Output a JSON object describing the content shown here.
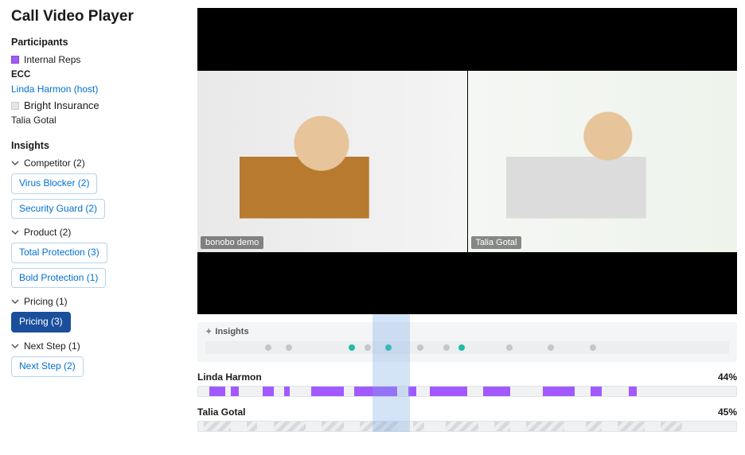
{
  "page_title": "Call Video Player",
  "participants": {
    "heading": "Participants",
    "legend_label": "Internal Reps",
    "legend_color": "#a259ff",
    "internal_org": "ECC",
    "internal_member": "Linda Harmon (host)",
    "external_org": "Bright Insurance",
    "external_member": "Talia Gotal"
  },
  "insights": {
    "heading": "Insights",
    "groups": [
      {
        "label": "Competitor",
        "count": 2,
        "chips": [
          {
            "label": "Virus Blocker",
            "count": 2,
            "active": false
          },
          {
            "label": "Security Guard",
            "count": 2,
            "active": false
          }
        ]
      },
      {
        "label": "Product",
        "count": 2,
        "chips": [
          {
            "label": "Total Protection",
            "count": 3,
            "active": false
          },
          {
            "label": "Bold Protection",
            "count": 1,
            "active": false
          }
        ]
      },
      {
        "label": "Pricing",
        "count": 1,
        "chips": [
          {
            "label": "Pricing",
            "count": 3,
            "active": true
          }
        ]
      },
      {
        "label": "Next Step",
        "count": 1,
        "chips": [
          {
            "label": "Next Step",
            "count": 2,
            "active": false
          }
        ]
      }
    ]
  },
  "video": {
    "tiles": [
      {
        "label": "bonobo demo"
      },
      {
        "label": "Talia Gotal"
      }
    ]
  },
  "timeline": {
    "insights_label": "Insights",
    "playhead_percent": 32.5,
    "playhead_width_percent": 6.9,
    "dots": [
      {
        "pos": 12,
        "kind": "grey"
      },
      {
        "pos": 16,
        "kind": "grey"
      },
      {
        "pos": 28,
        "kind": "teal"
      },
      {
        "pos": 31,
        "kind": "grey"
      },
      {
        "pos": 35,
        "kind": "teal"
      },
      {
        "pos": 41,
        "kind": "grey"
      },
      {
        "pos": 46,
        "kind": "grey"
      },
      {
        "pos": 49,
        "kind": "teal"
      },
      {
        "pos": 58,
        "kind": "grey"
      },
      {
        "pos": 66,
        "kind": "grey"
      },
      {
        "pos": 74,
        "kind": "grey"
      }
    ],
    "speakers": [
      {
        "name": "Linda Harmon",
        "percent": "44%",
        "segments": [
          {
            "start": 2,
            "width": 3,
            "kind": "purple"
          },
          {
            "start": 6,
            "width": 1.5,
            "kind": "purple"
          },
          {
            "start": 12,
            "width": 2,
            "kind": "purple"
          },
          {
            "start": 16,
            "width": 1,
            "kind": "purple"
          },
          {
            "start": 21,
            "width": 6,
            "kind": "purple"
          },
          {
            "start": 29,
            "width": 8,
            "kind": "purple"
          },
          {
            "start": 39,
            "width": 1.5,
            "kind": "purple"
          },
          {
            "start": 43,
            "width": 7,
            "kind": "purple"
          },
          {
            "start": 53,
            "width": 5,
            "kind": "purple"
          },
          {
            "start": 64,
            "width": 6,
            "kind": "purple"
          },
          {
            "start": 73,
            "width": 2,
            "kind": "purple"
          },
          {
            "start": 80,
            "width": 1.5,
            "kind": "purple"
          }
        ]
      },
      {
        "name": "Talia Gotal",
        "percent": "45%",
        "segments": [
          {
            "start": 1,
            "width": 5,
            "kind": "hatched"
          },
          {
            "start": 9,
            "width": 2,
            "kind": "hatched"
          },
          {
            "start": 14,
            "width": 6,
            "kind": "hatched"
          },
          {
            "start": 23,
            "width": 4,
            "kind": "hatched"
          },
          {
            "start": 30,
            "width": 7,
            "kind": "hatched"
          },
          {
            "start": 40,
            "width": 2,
            "kind": "hatched"
          },
          {
            "start": 46,
            "width": 6,
            "kind": "hatched"
          },
          {
            "start": 55,
            "width": 3,
            "kind": "hatched"
          },
          {
            "start": 61,
            "width": 7,
            "kind": "hatched"
          },
          {
            "start": 72,
            "width": 3,
            "kind": "hatched"
          },
          {
            "start": 78,
            "width": 5,
            "kind": "hatched"
          },
          {
            "start": 86,
            "width": 4,
            "kind": "hatched"
          }
        ]
      }
    ]
  }
}
